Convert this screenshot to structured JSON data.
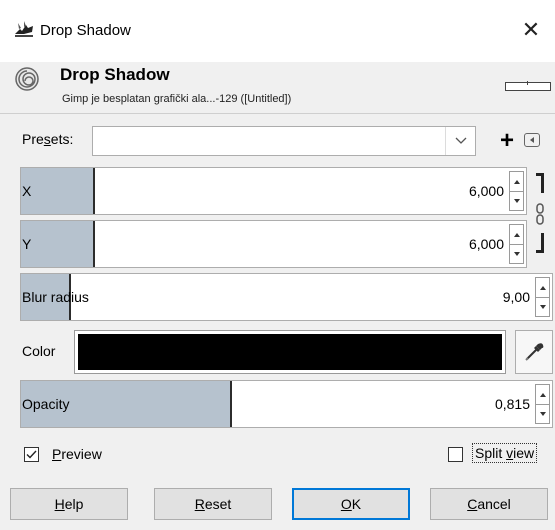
{
  "window": {
    "title": "Drop Shadow",
    "close_glyph": "✕"
  },
  "header": {
    "title": "Drop Shadow",
    "subtitle": "Gimp je besplatan grafički ala...-129 ([Untitled])"
  },
  "presets": {
    "label_pre": "Pre",
    "label_u": "s",
    "label_post": "ets:",
    "value": ""
  },
  "fields": {
    "x": {
      "label": "X",
      "value": "6,000",
      "fill_fraction": 0.13
    },
    "y": {
      "label": "Y",
      "value": "6,000",
      "fill_fraction": 0.13
    },
    "blur": {
      "label": "Blur radius",
      "value": "9,00",
      "fill_fraction": 0.09
    },
    "opacity": {
      "label": "Opacity",
      "value": "0,815",
      "fill_fraction": 0.39
    }
  },
  "color": {
    "label": "Color",
    "swatch": "#000000"
  },
  "preview": {
    "label_u": "P",
    "label_rest": "review",
    "checked": true
  },
  "split_view": {
    "label_pre": "Split ",
    "label_u": "v",
    "label_post": "iew",
    "checked": false
  },
  "buttons": {
    "help": {
      "u": "H",
      "rest": "elp"
    },
    "reset": {
      "u": "R",
      "rest": "eset"
    },
    "ok": {
      "u": "O",
      "rest": "K"
    },
    "cancel": {
      "u": "C",
      "rest": "ancel"
    }
  },
  "icons": {
    "title": "gimp-wilber-icon",
    "header": "gimp-spiral-icon",
    "dropdown": "chevron-down-icon",
    "add": "plus-icon",
    "menu": "preset-menu-icon",
    "chain": "chain-link-icon",
    "picker": "eyedropper-icon",
    "check": "checkmark-icon"
  },
  "colors": {
    "fill": "#b6c2ce",
    "default_button_border": "#0078d7"
  }
}
